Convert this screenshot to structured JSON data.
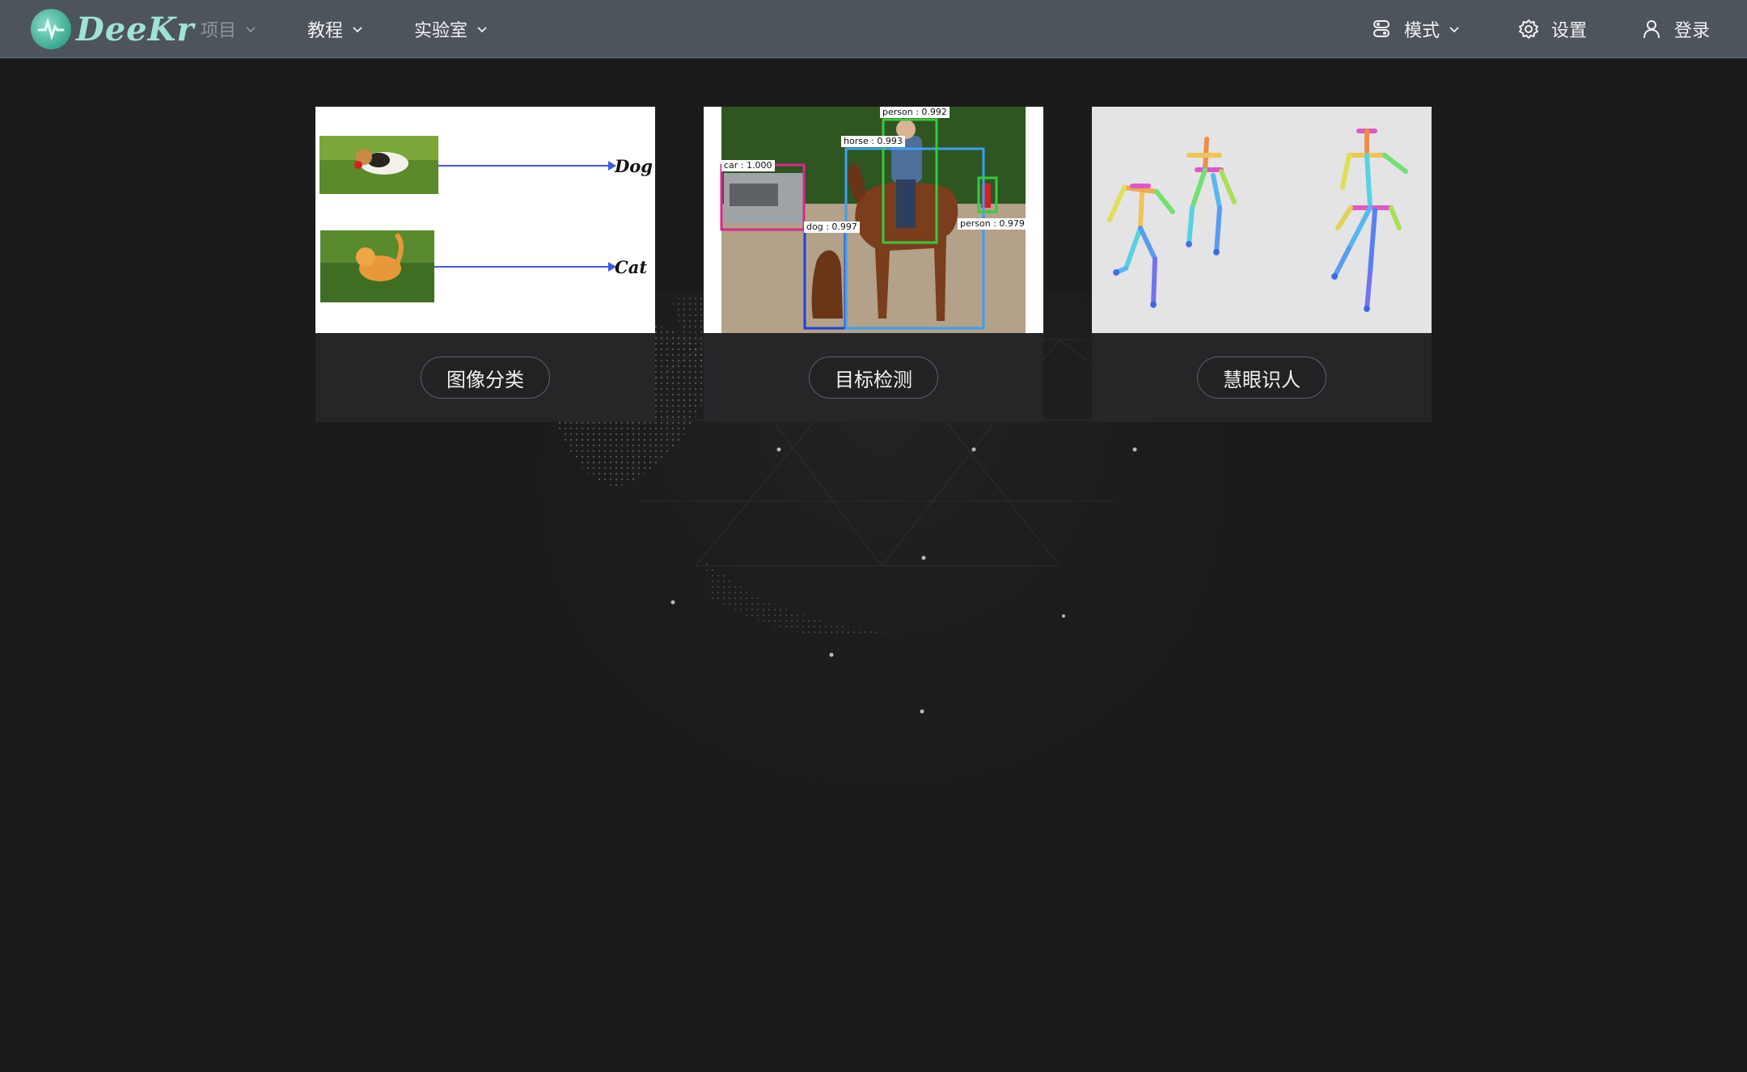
{
  "app": {
    "logo_text": "DeeKr"
  },
  "nav": {
    "left": [
      {
        "label": "项目",
        "disabled": true
      },
      {
        "label": "教程",
        "disabled": false
      },
      {
        "label": "实验室",
        "disabled": false
      }
    ],
    "right": [
      {
        "label": "模式",
        "icon": "mode-icon",
        "has_dropdown": true
      },
      {
        "label": "设置",
        "icon": "gear-icon",
        "has_dropdown": false
      },
      {
        "label": "登录",
        "icon": "user-icon",
        "has_dropdown": false
      }
    ]
  },
  "cards": [
    {
      "button_label": "图像分类",
      "image": {
        "labels": [
          "Dog",
          "Cat"
        ]
      }
    },
    {
      "button_label": "目标检测",
      "image": {
        "detections": [
          {
            "label": "person : 0.992",
            "color": "#38c93f"
          },
          {
            "label": "horse : 0.993",
            "color": "#3aa0ef"
          },
          {
            "label": "car : 1.000",
            "color": "#d8288a"
          },
          {
            "label": "dog : 0.997",
            "color": "#1f3fd6"
          },
          {
            "label": "person : 0.979",
            "color": "#38c93f"
          }
        ]
      }
    },
    {
      "button_label": "慧眼识人",
      "image": {
        "description": "pose skeletons"
      }
    }
  ],
  "colors": {
    "topbar": "#4d545c",
    "background": "#1b1b1c",
    "card": "#262629",
    "accent": "#3aa78f"
  }
}
